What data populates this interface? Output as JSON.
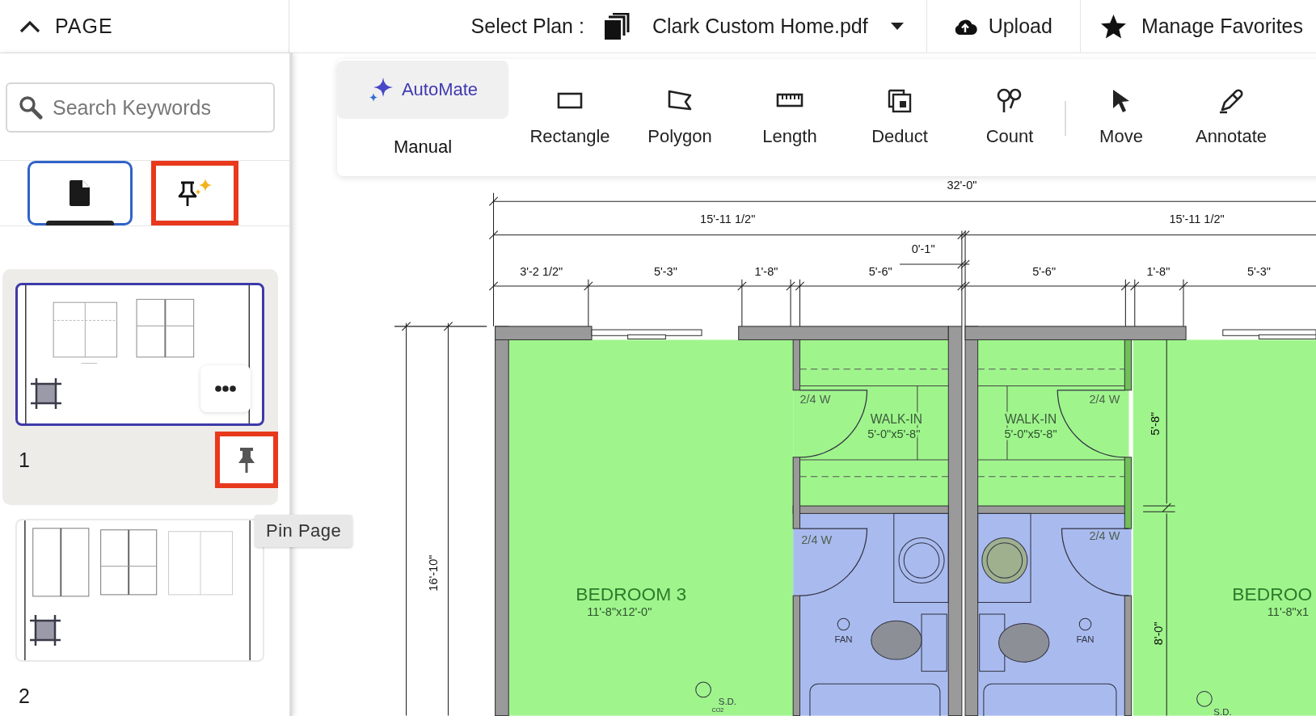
{
  "sidebar": {
    "header": {
      "label": "PAGE",
      "expanded": true
    },
    "search": {
      "placeholder": "Search Keywords"
    },
    "tabs": [
      {
        "kind": "pages",
        "selected": true,
        "highlighted": false
      },
      {
        "kind": "pinned",
        "selected": false,
        "highlighted": true
      }
    ],
    "pages": [
      {
        "number": "1",
        "selected": true,
        "pin_shown": true,
        "pin_highlighted": true,
        "menu_shown": true
      },
      {
        "number": "2",
        "selected": false,
        "pin_shown": false,
        "menu_shown": false
      }
    ],
    "tooltip": "Pin Page"
  },
  "topbar": {
    "plan_label": "Select Plan :",
    "plan_value": "Clark Custom Home.pdf",
    "buttons": [
      {
        "kind": "upload",
        "label": "Upload"
      },
      {
        "kind": "favorites",
        "label": "Manage Favorites"
      }
    ]
  },
  "toolbar": {
    "modes": [
      {
        "kind": "automate",
        "label": "AutoMate",
        "selected": true
      },
      {
        "kind": "manual",
        "label": "Manual",
        "selected": false
      }
    ],
    "tools": [
      {
        "kind": "rectangle",
        "label": "Rectangle",
        "separator_before": false
      },
      {
        "kind": "polygon",
        "label": "Polygon",
        "separator_before": false
      },
      {
        "kind": "length",
        "label": "Length",
        "separator_before": false
      },
      {
        "kind": "deduct",
        "label": "Deduct",
        "separator_before": false
      },
      {
        "kind": "count",
        "label": "Count",
        "separator_before": false
      },
      {
        "kind": "move",
        "label": "Move",
        "separator_before": true
      },
      {
        "kind": "annotate",
        "label": "Annotate",
        "separator_before": false
      }
    ]
  },
  "plan": {
    "labels": [
      {
        "kind": "dimension",
        "text": "32'-0\""
      },
      {
        "kind": "dimension",
        "text": "15'-11 1/2\""
      },
      {
        "kind": "dimension",
        "text": "15'-11 1/2\""
      },
      {
        "kind": "dimension",
        "text": "0'-1\""
      },
      {
        "kind": "dimension",
        "text": "3'-2 1/2\""
      },
      {
        "kind": "dimension",
        "text": "5'-3\""
      },
      {
        "kind": "dimension",
        "text": "1'-8\""
      },
      {
        "kind": "dimension",
        "text": "5'-6\""
      },
      {
        "kind": "dimension",
        "text": "5'-6\""
      },
      {
        "kind": "dimension",
        "text": "1'-8\""
      },
      {
        "kind": "dimension",
        "text": "5'-3\""
      },
      {
        "kind": "door",
        "text": "2/4 W"
      },
      {
        "kind": "room",
        "text": "WALK-IN"
      },
      {
        "kind": "size",
        "text": "5'-0\"x5'-8\""
      },
      {
        "kind": "room",
        "text": "WALK-IN"
      },
      {
        "kind": "size",
        "text": "5'-0\"x5'-8\""
      },
      {
        "kind": "door",
        "text": "2/4 W"
      },
      {
        "kind": "dimension",
        "text": "5'-8\""
      },
      {
        "kind": "door",
        "text": "2/4 W"
      },
      {
        "kind": "door",
        "text": "2/4 W"
      },
      {
        "kind": "dimension",
        "text": "16'-10\""
      },
      {
        "kind": "bedroom",
        "text": "BEDROOM 3"
      },
      {
        "kind": "size",
        "text": "11'-8\"x12'-0\""
      },
      {
        "kind": "bedroom",
        "text": "BEDROO"
      },
      {
        "kind": "size",
        "text": "11'-8\"x1"
      },
      {
        "kind": "fixture",
        "text": "FAN"
      },
      {
        "kind": "fixture",
        "text": "FAN"
      },
      {
        "kind": "dimension",
        "text": "8'-0\""
      },
      {
        "kind": "fixture",
        "text": "S.D."
      },
      {
        "kind": "tiny",
        "text": "CO2"
      },
      {
        "kind": "fixture",
        "text": "S.D."
      }
    ]
  }
}
